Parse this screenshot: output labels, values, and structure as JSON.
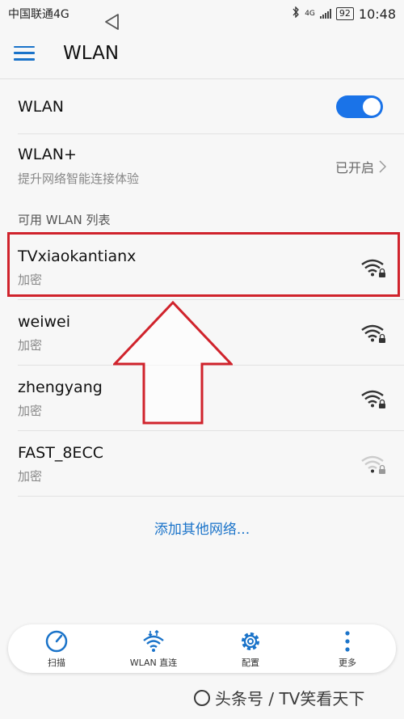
{
  "status_bar": {
    "carrier": "中国联通4G",
    "network": "4G",
    "battery": "92",
    "time": "10:48"
  },
  "app_bar": {
    "menu_icon": "hamburger-icon",
    "title": "WLAN"
  },
  "wlan_toggle": {
    "label": "WLAN",
    "on": true,
    "accent_color": "#1a73e8"
  },
  "wlan_plus": {
    "label": "WLAN+",
    "description": "提升网络智能连接体验",
    "status": "已开启"
  },
  "networks_header": "可用 WLAN 列表",
  "networks": [
    {
      "name": "TVxiaokantianx",
      "security": "加密",
      "signal": 3
    },
    {
      "name": "weiwei",
      "security": "加密",
      "signal": 3
    },
    {
      "name": "zhengyang",
      "security": "加密",
      "signal": 3
    },
    {
      "name": "FAST_8ECC",
      "security": "加密",
      "signal": 1
    }
  ],
  "add_network": "添加其他网络...",
  "bottom_tabs": [
    {
      "label": "扫描",
      "icon": "scan-icon"
    },
    {
      "label": "WLAN 直连",
      "icon": "wifi-direct-icon"
    },
    {
      "label": "配置",
      "icon": "gear-icon"
    },
    {
      "label": "更多",
      "icon": "more-icon"
    }
  ],
  "watermark": "头条号 / TV笑看天下",
  "highlight_color": "#d0232c"
}
